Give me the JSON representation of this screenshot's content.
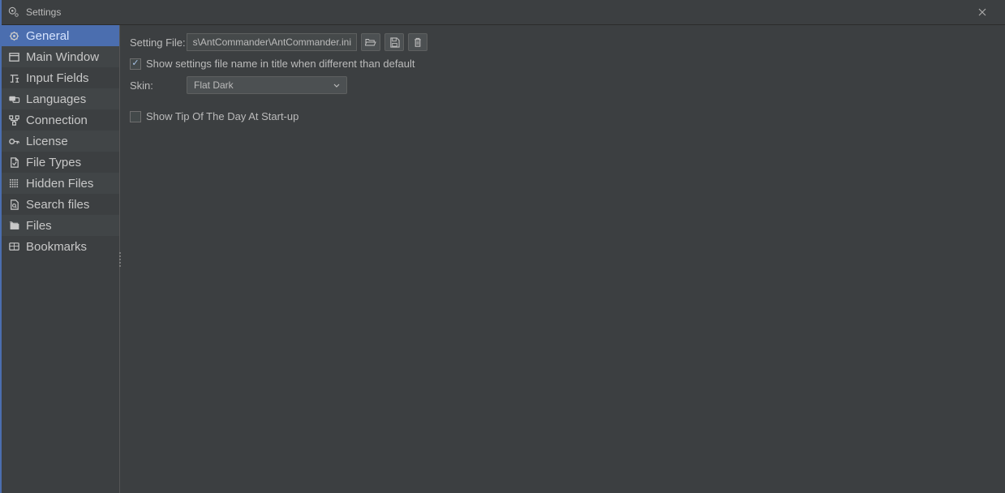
{
  "window": {
    "title": "Settings"
  },
  "sidebar": {
    "items": [
      {
        "label": "General",
        "icon": "gear-icon",
        "selected": true,
        "alt": false
      },
      {
        "label": "Main Window",
        "icon": "window-icon",
        "selected": false,
        "alt": true
      },
      {
        "label": "Input Fields",
        "icon": "text-icon",
        "selected": false,
        "alt": false
      },
      {
        "label": "Languages",
        "icon": "language-icon",
        "selected": false,
        "alt": true
      },
      {
        "label": "Connection",
        "icon": "connection-icon",
        "selected": false,
        "alt": false
      },
      {
        "label": "License",
        "icon": "key-icon",
        "selected": false,
        "alt": true
      },
      {
        "label": "File Types",
        "icon": "filetype-icon",
        "selected": false,
        "alt": false
      },
      {
        "label": "Hidden Files",
        "icon": "grid-icon",
        "selected": false,
        "alt": true
      },
      {
        "label": "Search files",
        "icon": "search-file-icon",
        "selected": false,
        "alt": false
      },
      {
        "label": "Files",
        "icon": "files-icon",
        "selected": false,
        "alt": true
      },
      {
        "label": "Bookmarks",
        "icon": "bookmark-icon",
        "selected": false,
        "alt": false
      }
    ]
  },
  "content": {
    "setting_file_label": "Setting File:",
    "setting_file_value": "s\\AntCommander\\AntCommander.ini",
    "show_name_checked": true,
    "show_name_label": "Show settings file name in title when different than default",
    "skin_label": "Skin:",
    "skin_value": "Flat Dark",
    "tip_checked": false,
    "tip_label": "Show Tip Of The Day At Start-up"
  }
}
